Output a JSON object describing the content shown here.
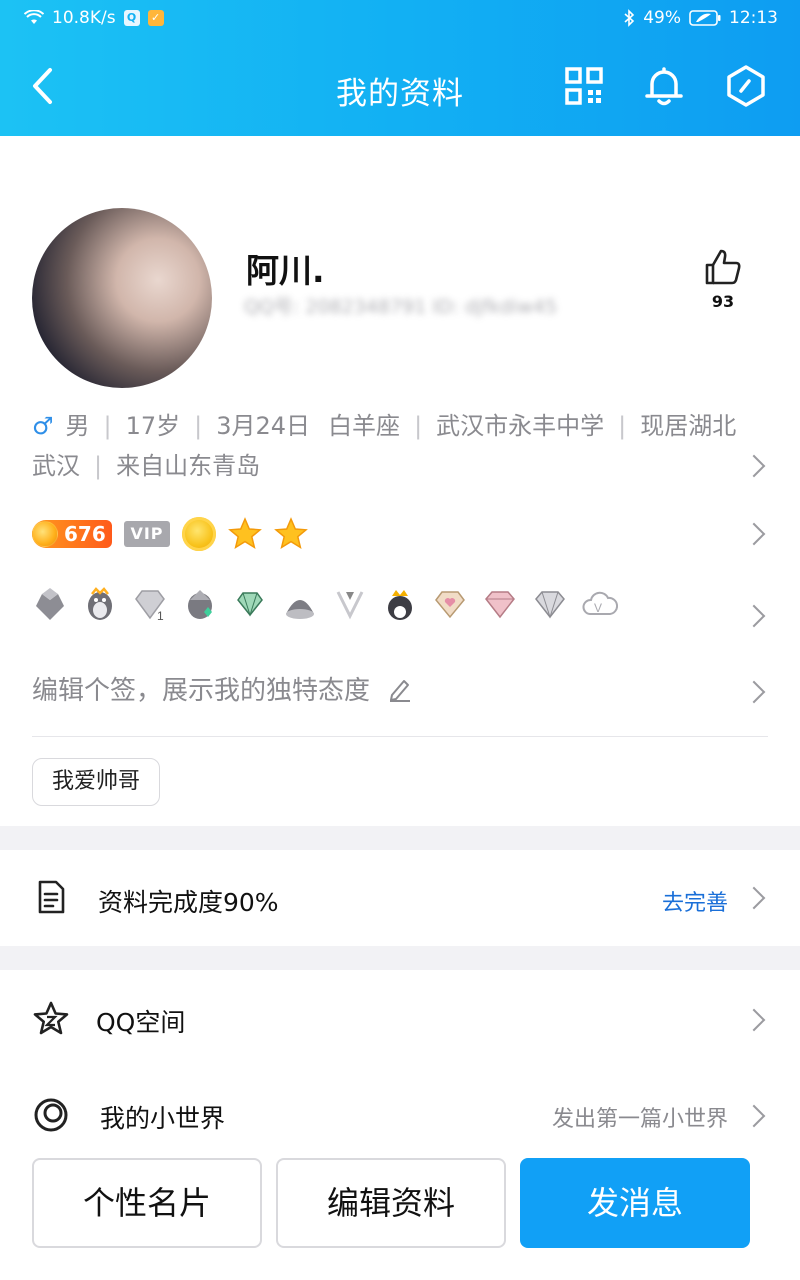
{
  "status": {
    "speed": "10.8K/s",
    "battery": "49%",
    "time": "12:13"
  },
  "nav": {
    "title": "我的资料"
  },
  "profile": {
    "name": "阿川.",
    "qq_line": "QQ号: 2082348791 ID: djfkdiw45",
    "likes": "93"
  },
  "info": {
    "gender": "男",
    "age": "17岁",
    "birthday": "3月24日",
    "zodiac": "白羊座",
    "school": "武汉市永丰中学",
    "residence": "现居湖北",
    "residence_city": "武汉",
    "hometown": "来自山东青岛"
  },
  "level": {
    "score": "676",
    "vip": "VIP"
  },
  "signature": {
    "placeholder": "编辑个签，展示我的独特态度"
  },
  "tag": {
    "label": "我爱帅哥"
  },
  "completion": {
    "label": "资料完成度90%",
    "action": "去完善"
  },
  "qzone": {
    "label": "QQ空间"
  },
  "world": {
    "label": "我的小世界",
    "meta": "发出第一篇小世界"
  },
  "buttons": {
    "card": "个性名片",
    "edit": "编辑资料",
    "message": "发消息"
  },
  "colors": {
    "accent": "#12b0f3",
    "link": "#1a6fd8",
    "gender": "#2f8fe8"
  }
}
